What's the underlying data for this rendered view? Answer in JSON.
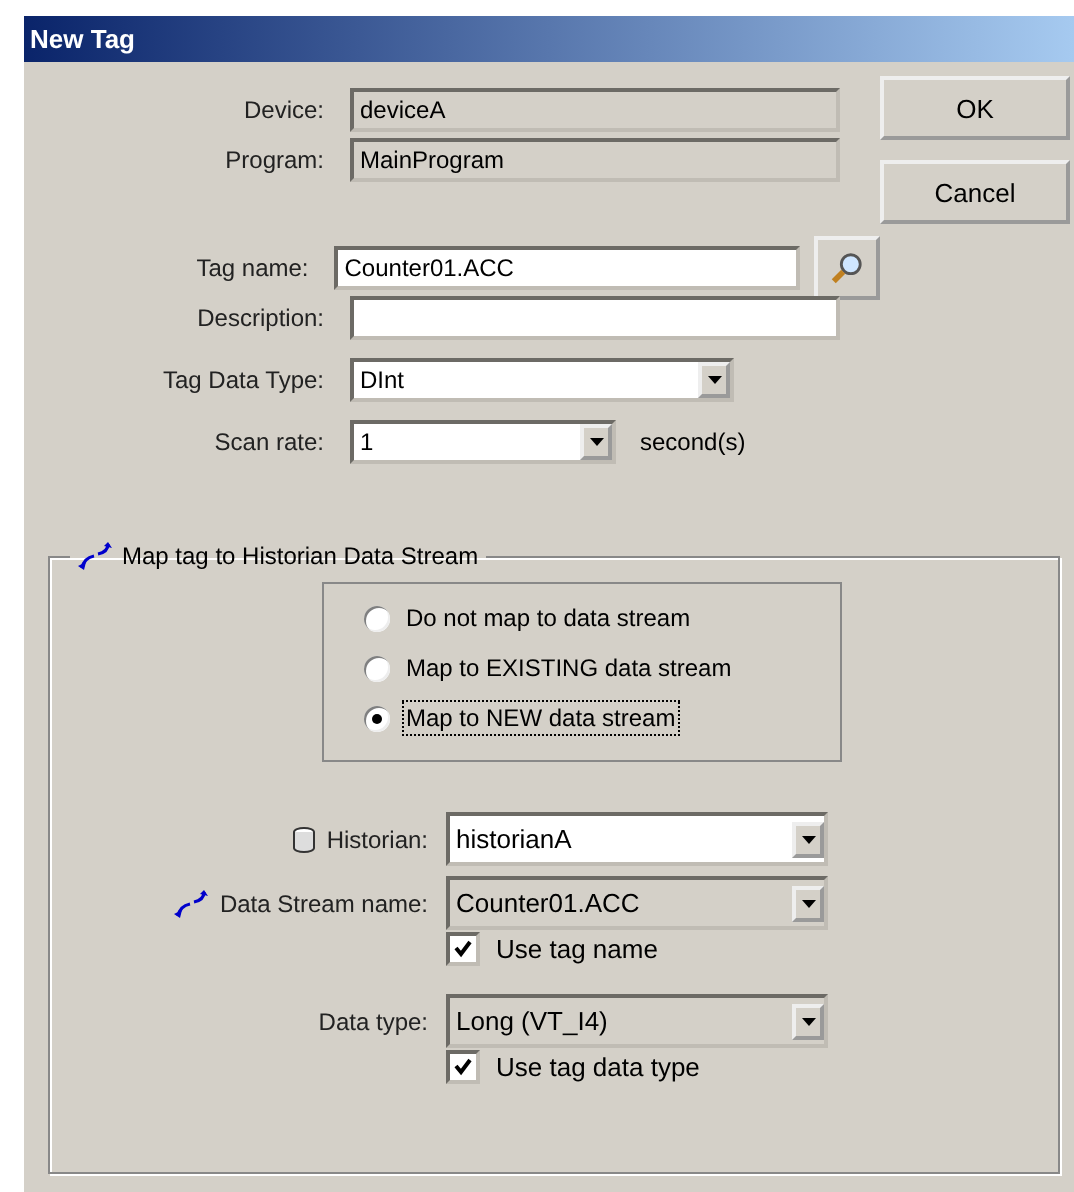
{
  "window": {
    "title": "New Tag"
  },
  "buttons": [
    {
      "label": "OK"
    },
    {
      "label": "Cancel"
    }
  ],
  "fields": [
    {
      "label": "Device:",
      "value": "deviceA",
      "kind": "text",
      "disabled": true,
      "lookup": false
    },
    {
      "label": "Program:",
      "value": "MainProgram",
      "kind": "text",
      "disabled": true,
      "lookup": false
    },
    {
      "label": "Tag name:",
      "value": "Counter01.ACC",
      "kind": "text",
      "disabled": false,
      "lookup": true
    },
    {
      "label": "Description:",
      "kind": "text",
      "disabled": false,
      "lookup": false
    },
    {
      "label": "Tag Data Type:",
      "value": "DInt",
      "kind": "combo",
      "disabled": false,
      "lookup": false
    },
    {
      "label": "Scan rate:",
      "value": "1",
      "kind": "combo",
      "disabled": false,
      "lookup": false,
      "unit": "second(s)"
    }
  ],
  "group": {
    "title": "Map tag to Historian Data Stream",
    "options": [
      {
        "label": "Do not map to data stream",
        "selected": false
      },
      {
        "label": "Map to EXISTING data stream",
        "selected": false
      },
      {
        "label": "Map to NEW data stream",
        "selected": true
      }
    ],
    "fields": [
      {
        "label": "Historian:",
        "value": "historianA",
        "disabled": false
      },
      {
        "label": "Data Stream name:",
        "value": "Counter01.ACC",
        "disabled": true,
        "checkbox": {
          "label": "Use tag name",
          "checked": true
        }
      },
      {
        "label": "Data type:",
        "value": "Long (VT_I4)",
        "disabled": true,
        "checkbox": {
          "label": "Use tag data type",
          "checked": true
        }
      }
    ]
  }
}
